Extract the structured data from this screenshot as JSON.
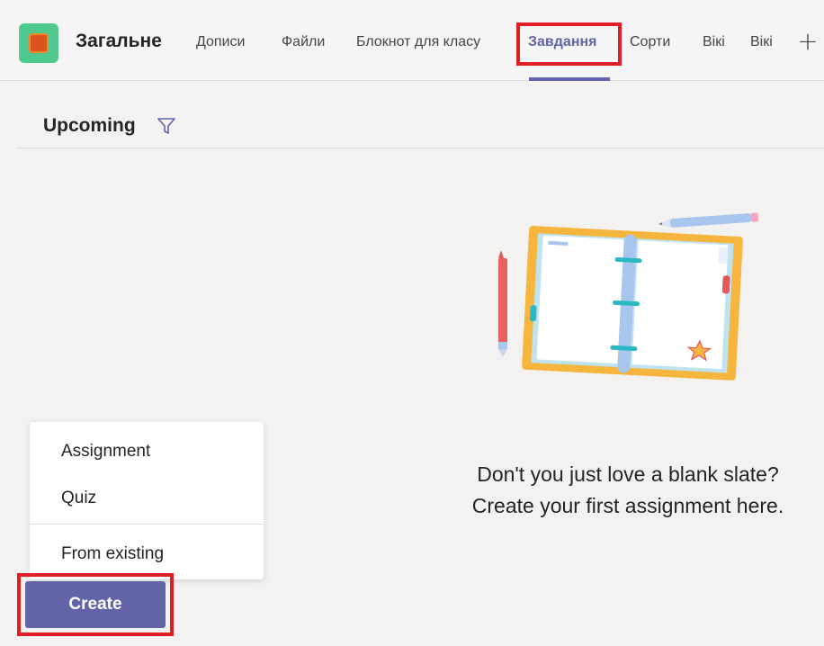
{
  "header": {
    "channel_name": "Загальне",
    "tabs": [
      {
        "label": "Дописи"
      },
      {
        "label": "Файли"
      },
      {
        "label": "Блокнот для класу"
      },
      {
        "label": "Завдання"
      },
      {
        "label": "Сорти"
      },
      {
        "label": "Вікі"
      },
      {
        "label": "Вікі"
      }
    ],
    "active_tab": "Завдання",
    "add_tab_icon": "plus-icon"
  },
  "filter": {
    "label": "Upcoming",
    "icon": "filter-icon"
  },
  "empty_state": {
    "line1": "Don't you just love a blank slate?",
    "line2": "Create your first assignment here."
  },
  "create_menu": {
    "items": [
      {
        "label": "Assignment"
      },
      {
        "label": "Quiz"
      },
      {
        "label": "From existing"
      }
    ]
  },
  "create_button": {
    "label": "Create"
  },
  "colors": {
    "accent": "#6264a7",
    "highlight": "#e31d24",
    "background": "#f3f2f1"
  }
}
